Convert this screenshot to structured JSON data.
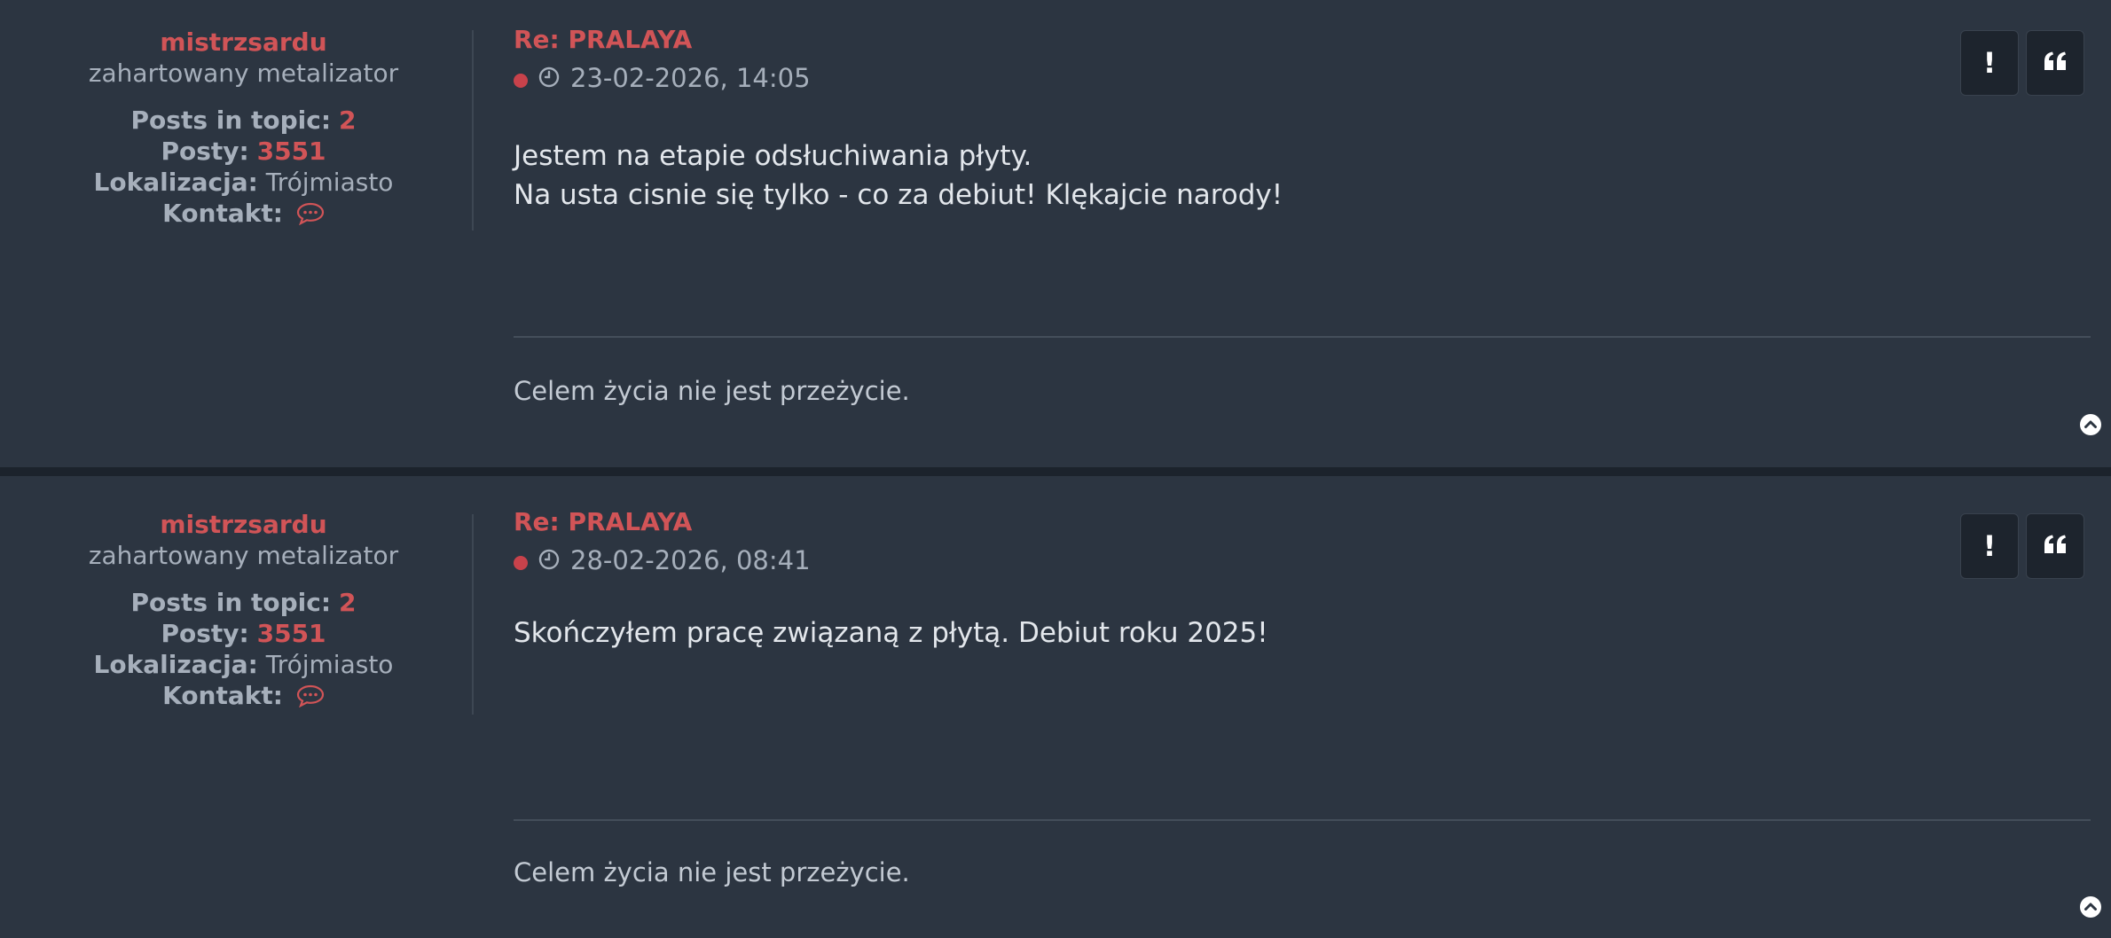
{
  "colors": {
    "accent": "#d15457",
    "background": "#2c3541",
    "separator": "#1c232c",
    "text": "#e3e7ec",
    "muted": "#a6afbb"
  },
  "posts": [
    {
      "author": {
        "username": "mistrzsardu",
        "rank": "zahartowany metalizator",
        "posts_in_topic_label": "Posts in topic:",
        "posts_in_topic": "2",
        "posts_label": "Posty:",
        "posts": "3551",
        "location_label": "Lokalizacja:",
        "location": "Trójmiasto",
        "contact_label": "Kontakt:",
        "contact_icon": "speech-bubble-icon"
      },
      "title": "Re: PRALAYA",
      "datetime": "23-02-2026, 14:05",
      "body": [
        "Jestem na etapie odsłuchiwania płyty.",
        "Na usta cisnie się tylko - co za debiut! Klękajcie narody!"
      ],
      "signature": "Celem życia nie jest przeżycie.",
      "report_label": "!",
      "quote_icon": "quote-icon"
    },
    {
      "author": {
        "username": "mistrzsardu",
        "rank": "zahartowany metalizator",
        "posts_in_topic_label": "Posts in topic:",
        "posts_in_topic": "2",
        "posts_label": "Posty:",
        "posts": "3551",
        "location_label": "Lokalizacja:",
        "location": "Trójmiasto",
        "contact_label": "Kontakt:",
        "contact_icon": "speech-bubble-icon"
      },
      "title": "Re: PRALAYA",
      "datetime": "28-02-2026, 08:41",
      "body": [
        "Skończyłem pracę związaną z płytą. Debiut roku 2025!"
      ],
      "signature": "Celem życia nie jest przeżycie.",
      "report_label": "!",
      "quote_icon": "quote-icon"
    }
  ]
}
